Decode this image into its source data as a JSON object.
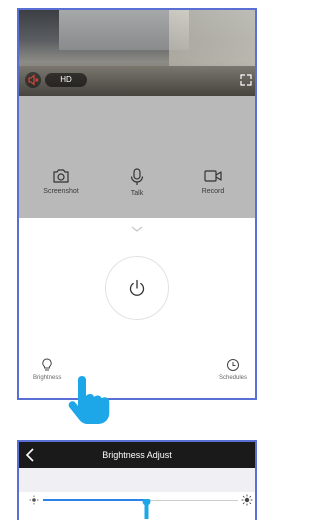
{
  "player": {
    "quality_label": "HD",
    "controls": [
      {
        "label": "Screenshot",
        "icon": "camera-icon"
      },
      {
        "label": "Talk",
        "icon": "microphone-icon"
      },
      {
        "label": "Record",
        "icon": "video-camera-icon"
      }
    ]
  },
  "actions": {
    "brightness_label": "Brightness",
    "schedules_label": "Schedules"
  },
  "brightness_screen": {
    "title": "Brightness Adjust",
    "slider_value": 0.47,
    "accent_color": "#2b83e8"
  },
  "colors": {
    "frame_border": "#5a6fd6",
    "nav_bar": "#1a1a1a",
    "hand_pointer": "#1ea7e8"
  }
}
